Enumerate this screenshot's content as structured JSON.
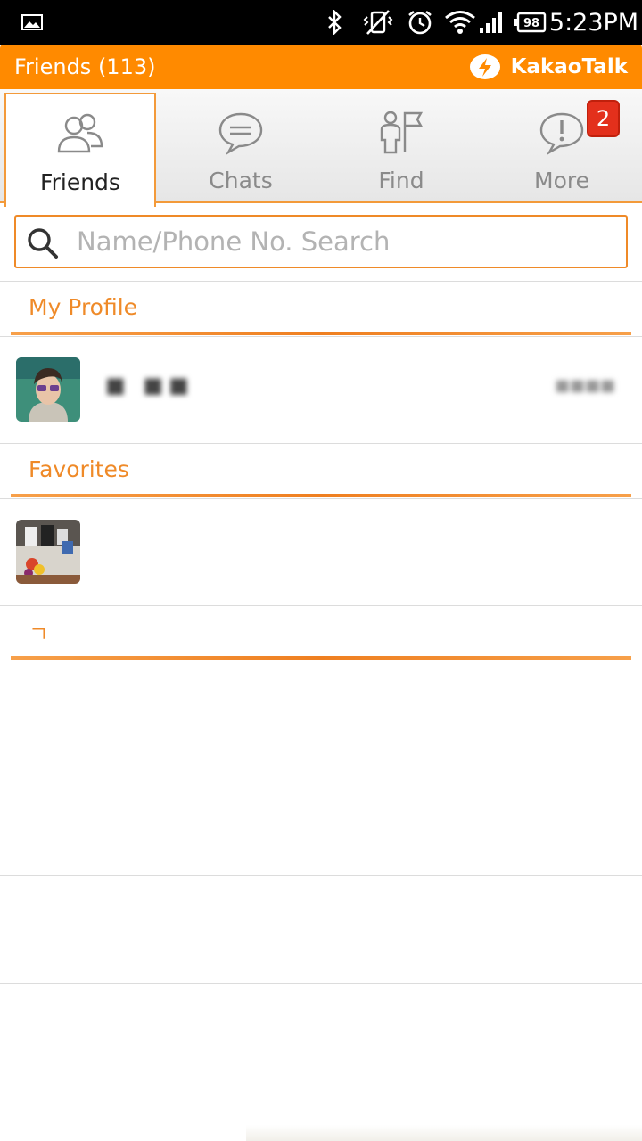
{
  "status_bar": {
    "time": "5:23PM",
    "battery": "98",
    "icons": [
      "image-icon",
      "bluetooth-icon",
      "vibrate-off-icon",
      "alarm-icon",
      "wifi-icon",
      "signal-icon",
      "battery-icon"
    ]
  },
  "header": {
    "title": "Friends (113)",
    "brand": "KakaoTalk"
  },
  "tabs": [
    {
      "label": "Friends",
      "icon": "friends-icon",
      "active": true
    },
    {
      "label": "Chats",
      "icon": "chat-bubble-icon",
      "active": false
    },
    {
      "label": "Find",
      "icon": "find-person-flag-icon",
      "active": false
    },
    {
      "label": "More",
      "icon": "more-exclamation-icon",
      "active": false,
      "badge": "2"
    }
  ],
  "search": {
    "placeholder": "Name/Phone No. Search",
    "value": ""
  },
  "sections": [
    {
      "title": "My Profile"
    },
    {
      "title": "Favorites"
    },
    {
      "title": "ㄱ"
    }
  ],
  "profile": {
    "name": "■ ■■",
    "status": "■■■■"
  },
  "colors": {
    "accent": "#ff8a00",
    "section_text": "#ef8a28",
    "badge": "#e3301c"
  }
}
